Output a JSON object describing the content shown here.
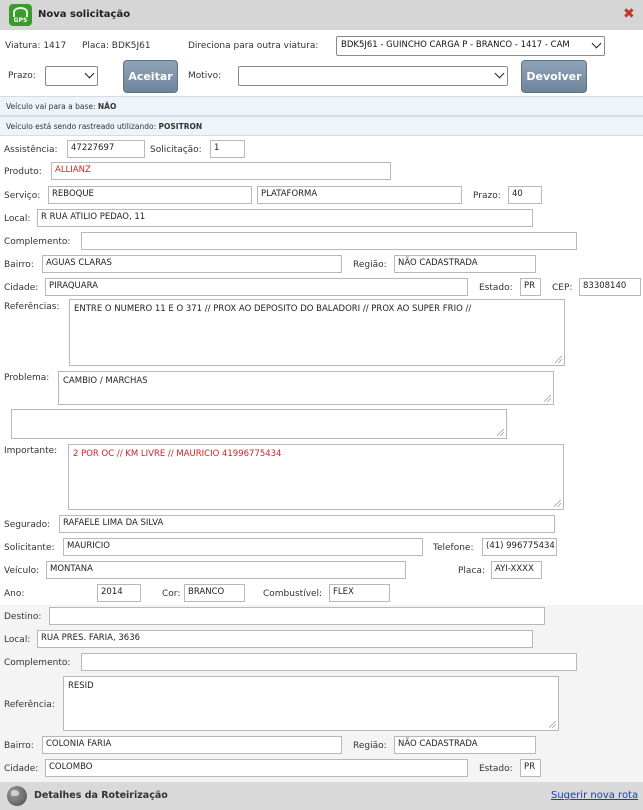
{
  "window": {
    "title": "Nova solicitação",
    "logo_text": "GPS"
  },
  "header": {
    "viatura_label": "Viatura: 1417",
    "placa_label": "Placa: BDK5J61",
    "direciona_label": "Direciona para outra viatura:",
    "direciona_value": "BDK5J61 - GUINCHO CARGA P - BRANCO - 1417 - CAM",
    "prazo_label": "Prazo:",
    "prazo_value": "",
    "aceitar_label": "Aceitar",
    "motivo_label": "Motivo:",
    "motivo_value": "",
    "devolver_label": "Devolver"
  },
  "info": {
    "base_text": "Veículo vai para a base:",
    "base_value": "NÃO",
    "rastreado_text": "Veículo está sendo rastreado utilizando:",
    "rastreado_value": "POSITRON"
  },
  "form": {
    "assistencia_label": "Assistência:",
    "assistencia_value": "47227697",
    "solicitacao_label": "Solicitação:",
    "solicitacao_value": "1",
    "produto_label": "Produto:",
    "produto_value": "ALLIANZ",
    "servico_label": "Serviço:",
    "servico_value": "REBOQUE",
    "servico_tipo_value": "PLATAFORMA",
    "prazo_label": "Prazo:",
    "prazo_value": "40",
    "local_label": "Local:",
    "local_value": "R RUA ATILIO PEDAO, 11",
    "complemento_label": "Complemento:",
    "complemento_value": "",
    "bairro_label": "Bairro:",
    "bairro_value": "AGUAS CLARAS",
    "regiao_label": "Região:",
    "regiao_value": "NÃO CADASTRADA",
    "cidade_label": "Cidade:",
    "cidade_value": "PIRAQUARA",
    "estado_label": "Estado:",
    "estado_value": "PR",
    "cep_label": "CEP:",
    "cep_value": "83308140",
    "referencias_label": "Referências:",
    "referencias_value": "ENTRE O NUMERO 11 E O 371 //  PROX AO DEPOSITO DO BALADORI // PROX  AO SUPER FRIO //",
    "problema_label": "Problema:",
    "problema_value": "CAMBIO / MARCHAS",
    "problema_extra_value": "",
    "importante_label": "Importante:",
    "importante_value": "2 POR OC // KM LIVRE //  MAURICIO 41996775434",
    "segurado_label": "Segurado:",
    "segurado_value": "RAFAELE LIMA DA SILVA",
    "solicitante_label": "Solicitante:",
    "solicitante_value": "MAURICIO",
    "telefone_label": "Telefone:",
    "telefone_value": "(41) 996775434",
    "veiculo_label": "Veículo:",
    "veiculo_value": "MONTANA",
    "placa_label": "Placa:",
    "placa_value": "AYI-XXXX",
    "ano_label": "Ano:",
    "ano_value": "2014",
    "cor_label": "Cor:",
    "cor_value": "BRANCO",
    "combustivel_label": "Combustível:",
    "combustivel_value": "FLEX"
  },
  "destino": {
    "destino_label": "Destino:",
    "destino_value": "",
    "local_label": "Local:",
    "local_value": "RUA PRES. FARIA, 3636",
    "complemento_label": "Complemento:",
    "complemento_value": "",
    "referencia_label": "Referência:",
    "referencia_value": "RESID",
    "bairro_label": "Bairro:",
    "bairro_value": "COLONIA FARIA",
    "regiao_label": "Região:",
    "regiao_value": "NÃO CADASTRADA",
    "cidade_label": "Cidade:",
    "cidade_value": "COLOMBO",
    "estado_label": "Estado:",
    "estado_value": "PR"
  },
  "footer": {
    "title": "Detalhes da Roteirização",
    "link_label": "Sugerir nova rota"
  },
  "colors": {
    "accent_red": "#d32020",
    "button": "#7b8fa4",
    "info_bg": "#eef4fa",
    "link": "#1a3fb8"
  }
}
